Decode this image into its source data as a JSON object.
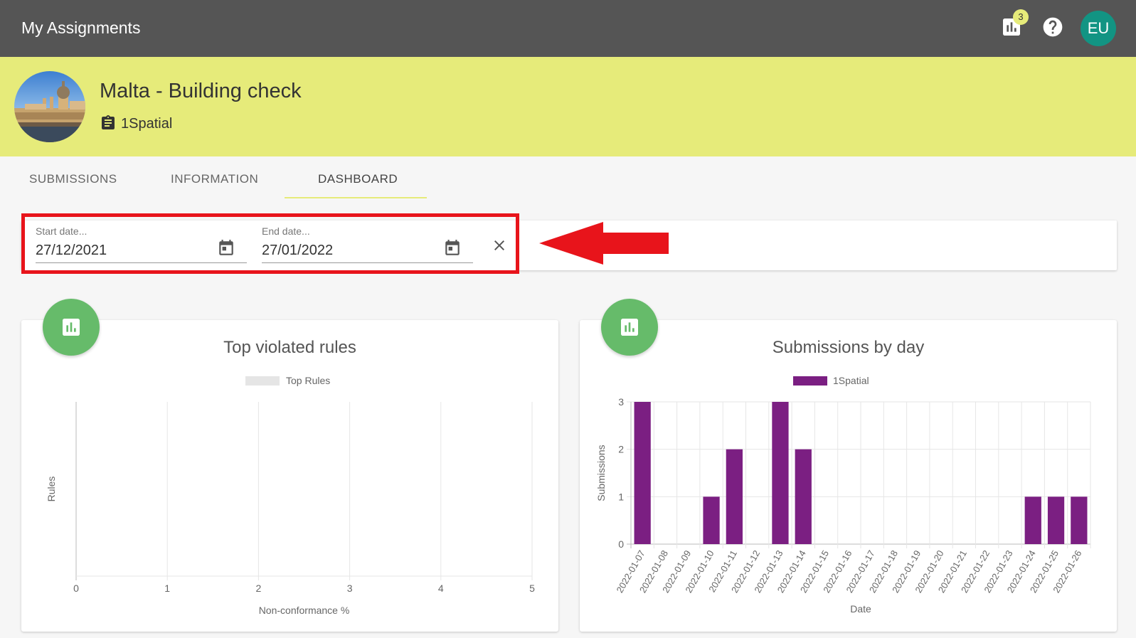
{
  "app": {
    "title": "My Assignments"
  },
  "topbar": {
    "notifications_count": "3",
    "notifications_icon": "bar-chart-icon",
    "help_icon": "help-icon",
    "user_initials": "EU",
    "avatar_color": "#129483"
  },
  "project": {
    "title": "Malta - Building check",
    "organization": "1Spatial",
    "org_icon": "clipboard-icon",
    "header_color": "#e6eb7a"
  },
  "tabs": [
    {
      "label": "SUBMISSIONS",
      "active": false
    },
    {
      "label": "INFORMATION",
      "active": false
    },
    {
      "label": "DASHBOARD",
      "active": true
    }
  ],
  "filters": {
    "start_label": "Start date...",
    "start_value": "27/12/2021",
    "end_label": "End date...",
    "end_value": "27/01/2022"
  },
  "charts": {
    "violated": {
      "title": "Top violated rules"
    },
    "submissions": {
      "title": "Submissions by day"
    }
  },
  "chart_data": [
    {
      "type": "bar",
      "orientation": "horizontal",
      "title": "Top violated rules",
      "legend": [
        "Top Rules"
      ],
      "series": [
        {
          "name": "Top Rules",
          "values": []
        }
      ],
      "categories": [],
      "xlabel": "Non-conformance %",
      "ylabel": "Rules",
      "xlim": [
        0,
        5
      ],
      "xticks": [
        "0",
        "1",
        "2",
        "3",
        "4",
        "5"
      ],
      "grid": true,
      "legend_position": "top",
      "colors": {
        "Top Rules": "#e5e5e5"
      }
    },
    {
      "type": "bar",
      "title": "Submissions by day",
      "legend": [
        "1Spatial"
      ],
      "categories": [
        "2022-01-07",
        "2022-01-08",
        "2022-01-09",
        "2022-01-10",
        "2022-01-11",
        "2022-01-12",
        "2022-01-13",
        "2022-01-14",
        "2022-01-15",
        "2022-01-16",
        "2022-01-17",
        "2022-01-18",
        "2022-01-19",
        "2022-01-20",
        "2022-01-21",
        "2022-01-22",
        "2022-01-23",
        "2022-01-24",
        "2022-01-25",
        "2022-01-26"
      ],
      "series": [
        {
          "name": "1Spatial",
          "values": [
            3,
            0,
            0,
            1,
            2,
            0,
            3,
            2,
            0,
            0,
            0,
            0,
            0,
            0,
            0,
            0,
            0,
            1,
            1,
            1
          ]
        }
      ],
      "xlabel": "Date",
      "ylabel": "Submissions",
      "ylim": [
        0,
        3
      ],
      "yticks": [
        "0",
        "1",
        "2",
        "3"
      ],
      "grid": true,
      "legend_position": "top",
      "colors": {
        "1Spatial": "#7b1f82"
      }
    }
  ]
}
